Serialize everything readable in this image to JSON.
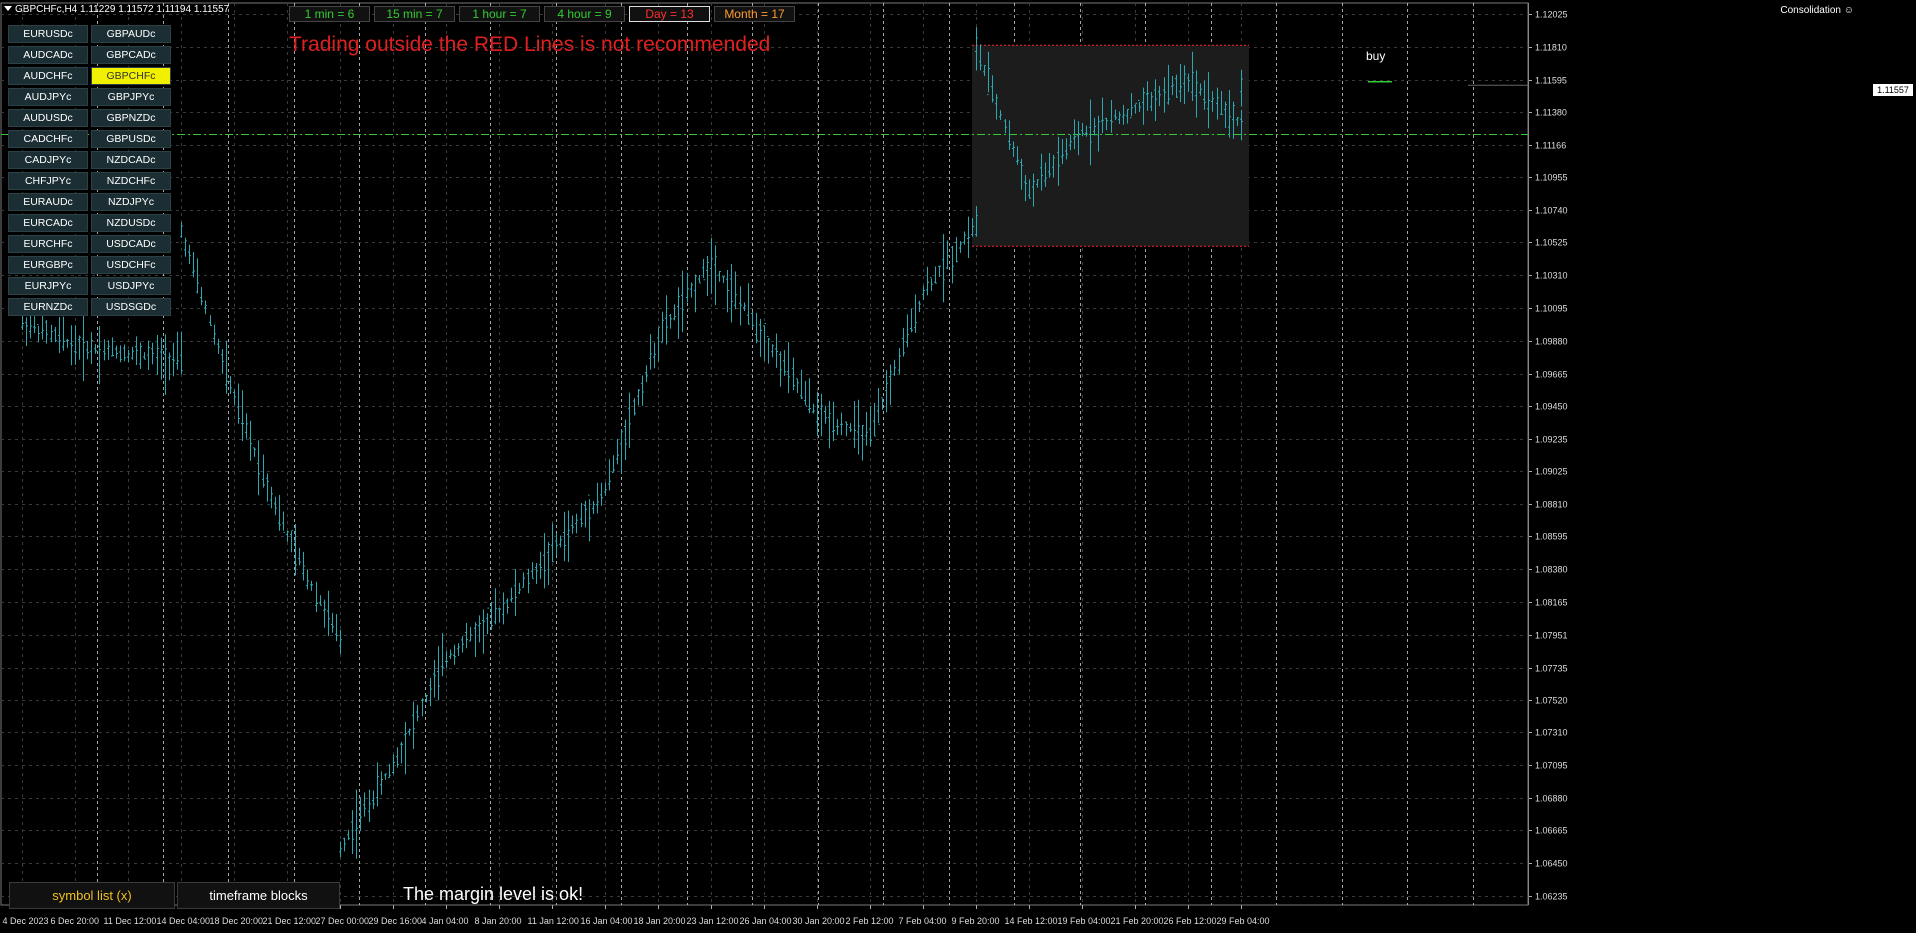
{
  "window": {
    "title": "GBPCHFc,H4  1.11229 1.11572 1.11194 1.11557",
    "indicator_name": "Consolidation",
    "indicator_icon": "smiley-icon"
  },
  "timeframe_blocks": [
    {
      "label": "1 min = 6",
      "color": "#33cc33"
    },
    {
      "label": "15 min = 7",
      "color": "#33cc33"
    },
    {
      "label": "1 hour = 7",
      "color": "#33cc33"
    },
    {
      "label": "4 hour = 9",
      "color": "#33cc33"
    },
    {
      "label": "Day = 13",
      "color": "#ff3030"
    },
    {
      "label": "Month = 17",
      "color": "#ff9933"
    }
  ],
  "warning_text": "Trading outside the RED Lines is not recommended",
  "symbols": {
    "left": [
      "EURUSDc",
      "AUDCADc",
      "AUDCHFc",
      "AUDJPYc",
      "AUDUSDc",
      "CADCHFc",
      "CADJPYc",
      "CHFJPYc",
      "EURAUDc",
      "EURCADc",
      "EURCHFc",
      "EURGBPc",
      "EURJPYc",
      "EURNZDc"
    ],
    "right": [
      "GBPAUDc",
      "GBPCADc",
      "GBPCHFc",
      "GBPJPYc",
      "GBPNZDc",
      "GBPUSDc",
      "NZDCADc",
      "NZDCHFc",
      "NZDJPYc",
      "NZDUSDc",
      "USDCADc",
      "USDCHFc",
      "USDJPYc",
      "USDSGDc"
    ],
    "selected": "GBPCHFc",
    "selected_color": "#f0f000"
  },
  "buttons": {
    "symbol_list": "symbol list (x)",
    "timeframe_blocks": "timeframe blocks"
  },
  "margin_message": "The margin level is ok!",
  "zone_label": "buy",
  "current_price_label": "1.11557",
  "colors": {
    "candles": "#2aa7b0",
    "grid": "#3a3a3a",
    "separators": "#cfcfcf",
    "zone_border": "#ff2020",
    "current_line": "#33cc33"
  },
  "chart_data": {
    "type": "line",
    "symbol": "GBPCHFc",
    "timeframe": "H4",
    "ylim": [
      1.06235,
      1.12025
    ],
    "y_ticks": [
      "1.12025",
      "1.11810",
      "1.11595",
      "1.11380",
      "1.11166",
      "1.10955",
      "1.10740",
      "1.10525",
      "1.10310",
      "1.10095",
      "1.09880",
      "1.09665",
      "1.09450",
      "1.09235",
      "1.09025",
      "1.08810",
      "1.08595",
      "1.08380",
      "1.08165",
      "1.07951",
      "1.07735",
      "1.07520",
      "1.07310",
      "1.07095",
      "1.06880",
      "1.06665",
      "1.06450",
      "1.06235"
    ],
    "x_ticks": [
      "4 Dec 2023",
      "6 Dec 20:00",
      "11 Dec 12:00",
      "14 Dec 04:00",
      "18 Dec 20:00",
      "21 Dec 12:00",
      "27 Dec 00:00",
      "29 Dec 16:00",
      "4 Jan 04:00",
      "8 Jan 20:00",
      "11 Jan 12:00",
      "16 Jan 04:00",
      "18 Jan 20:00",
      "23 Jan 12:00",
      "26 Jan 04:00",
      "30 Jan 20:00",
      "2 Feb 12:00",
      "7 Feb 04:00",
      "9 Feb 20:00",
      "14 Feb 12:00",
      "19 Feb 04:00",
      "21 Feb 20:00",
      "26 Feb 12:00",
      "29 Feb 04:00"
    ],
    "path": [
      [
        "4 Dec 2023",
        1.1
      ],
      [
        "6 Dec 20:00",
        1.0985
      ],
      [
        "11 Dec 12:00",
        1.098
      ],
      [
        "14 Dec 04:00",
        1.0975
      ],
      [
        "14 Dec 04:00",
        1.106
      ],
      [
        "18 Dec 20:00",
        1.095
      ],
      [
        "21 Dec 12:00",
        1.086
      ],
      [
        "27 Dec 00:00",
        1.079
      ],
      [
        "27 Dec 00:00",
        1.0655
      ],
      [
        "29 Dec 16:00",
        1.071
      ],
      [
        "4 Jan 04:00",
        1.078
      ],
      [
        "8 Jan 20:00",
        1.081
      ],
      [
        "11 Jan 12:00",
        1.085
      ],
      [
        "16 Jan 04:00",
        1.089
      ],
      [
        "18 Jan 20:00",
        1.099
      ],
      [
        "23 Jan 12:00",
        1.104
      ],
      [
        "26 Jan 04:00",
        1.099
      ],
      [
        "30 Jan 20:00",
        1.094
      ],
      [
        "2 Feb 12:00",
        1.0925
      ],
      [
        "7 Feb 04:00",
        1.102
      ],
      [
        "9 Feb 20:00",
        1.1065
      ],
      [
        "9 Feb 20:00",
        1.118
      ],
      [
        "14 Feb 12:00",
        1.1085
      ],
      [
        "19 Feb 04:00",
        1.1125
      ],
      [
        "21 Feb 20:00",
        1.114
      ],
      [
        "26 Feb 12:00",
        1.116
      ],
      [
        "29 Feb 04:00",
        1.113
      ],
      [
        "29 Feb 04:00",
        1.11557
      ]
    ],
    "current_price": 1.11557,
    "horizontal_line": 1.1124,
    "consolidation_zone": {
      "from": "9 Feb 20:00",
      "to": "29 Feb 04:00",
      "high": 1.1182,
      "low": 1.105
    },
    "grid": true
  }
}
